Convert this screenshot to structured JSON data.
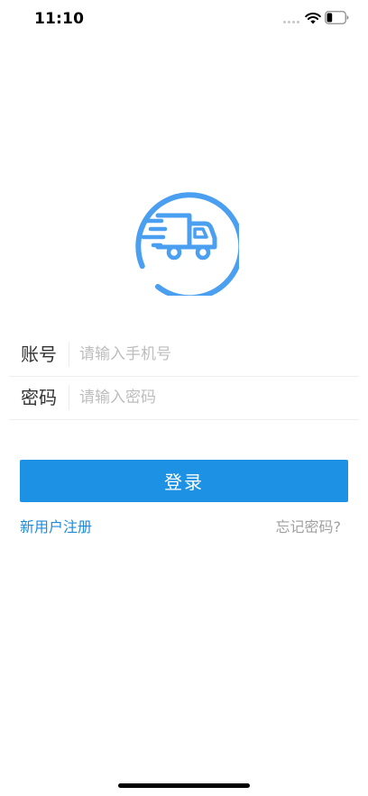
{
  "status_bar": {
    "time": "11:10",
    "battery_level": 0.3
  },
  "logo": {
    "icon": "delivery-truck-icon",
    "color": "#4a9ff0"
  },
  "form": {
    "account": {
      "label": "账号",
      "placeholder": "请输入手机号"
    },
    "password": {
      "label": "密码",
      "placeholder": "请输入密码"
    }
  },
  "actions": {
    "login_label": "登录",
    "register_label": "新用户注册",
    "forgot_label": "忘记密码?"
  },
  "colors": {
    "primary": "#1d91e4",
    "link": "#1f8bd8",
    "muted": "#a0a0a0"
  }
}
